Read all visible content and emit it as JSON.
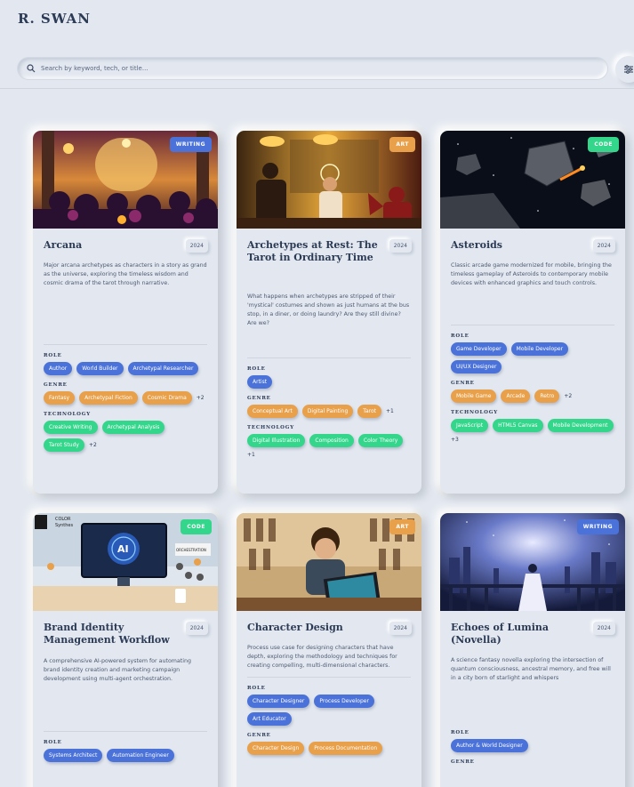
{
  "brand": "R. SWAN",
  "search": {
    "placeholder": "Search by keyword, tech, or title..."
  },
  "colors": {
    "writing": "#4a72d9",
    "art": "#e8a04a",
    "code": "#33d68a",
    "background": "#e3e8f0"
  },
  "labels": {
    "role": "ROLE",
    "genre": "GENRE",
    "technology": "TECHNOLOGY"
  },
  "cards": [
    {
      "category": "WRITING",
      "title": "Arcana",
      "year": "2024",
      "description": "Major arcana archetypes as characters in a story as grand as the universe, exploring the timeless wisdom and cosmic drama of the tarot through narrative.",
      "role": [
        "Author",
        "World Builder",
        "Archetypal Researcher"
      ],
      "genre": [
        "Fantasy",
        "Archetypal Fiction",
        "Cosmic Drama"
      ],
      "genre_more": "+2",
      "technology": [
        "Creative Writing",
        "Archetypal Analysis",
        "Tarot Study"
      ],
      "technology_more": "+2"
    },
    {
      "category": "ART",
      "title": "Archetypes at Rest: The Tarot in Ordinary Time",
      "year": "2024",
      "description": "What happens when archetypes are stripped of their 'mystical' costumes and shown as just humans at the bus stop, in a diner, or doing laundry? Are they still divine? Are we?",
      "role": [
        "Artist"
      ],
      "genre": [
        "Conceptual Art",
        "Digital Painting",
        "Tarot"
      ],
      "genre_more": "+1",
      "technology": [
        "Digital Illustration",
        "Composition",
        "Color Theory"
      ],
      "technology_more": "+1"
    },
    {
      "category": "CODE",
      "title": "Asteroids",
      "year": "2024",
      "description": "Classic arcade game modernized for mobile, bringing the timeless gameplay of Asteroids to contemporary mobile devices with enhanced graphics and touch controls.",
      "role": [
        "Game Developer",
        "Mobile Developer",
        "UI/UX Designer"
      ],
      "genre": [
        "Mobile Game",
        "Arcade",
        "Retro"
      ],
      "genre_more": "+2",
      "technology": [
        "JavaScript",
        "HTML5 Canvas",
        "Mobile Development"
      ],
      "technology_more": "+3"
    },
    {
      "category": "CODE",
      "title": "Brand Identity Management Workflow",
      "year": "2024",
      "description": "A comprehensive AI-powered system for automating brand identity creation and marketing campaign development using multi-agent orchestration.",
      "role": [
        "Systems Architect",
        "Automation Engineer"
      ],
      "thumb_text": {
        "ai": "AI",
        "color": "COLOR",
        "synthesis": "Synthes",
        "orchestration": "ORCHESTRATION"
      }
    },
    {
      "category": "ART",
      "title": "Character Design",
      "year": "2024",
      "description": "Process use case for designing characters that have depth, exploring the methodology and techniques for creating compelling, multi-dimensional characters.",
      "role": [
        "Character Designer",
        "Process Developer",
        "Art Educator"
      ],
      "genre": [
        "Character Design",
        "Process Documentation"
      ]
    },
    {
      "category": "WRITING",
      "title": "Echoes of Lumina (Novella)",
      "year": "2024",
      "description": "A science fantasy novella exploring the intersection of quantum consciousness, ancestral memory, and free will in a city born of starlight and whispers",
      "role": [
        "Author & World Designer"
      ]
    }
  ]
}
